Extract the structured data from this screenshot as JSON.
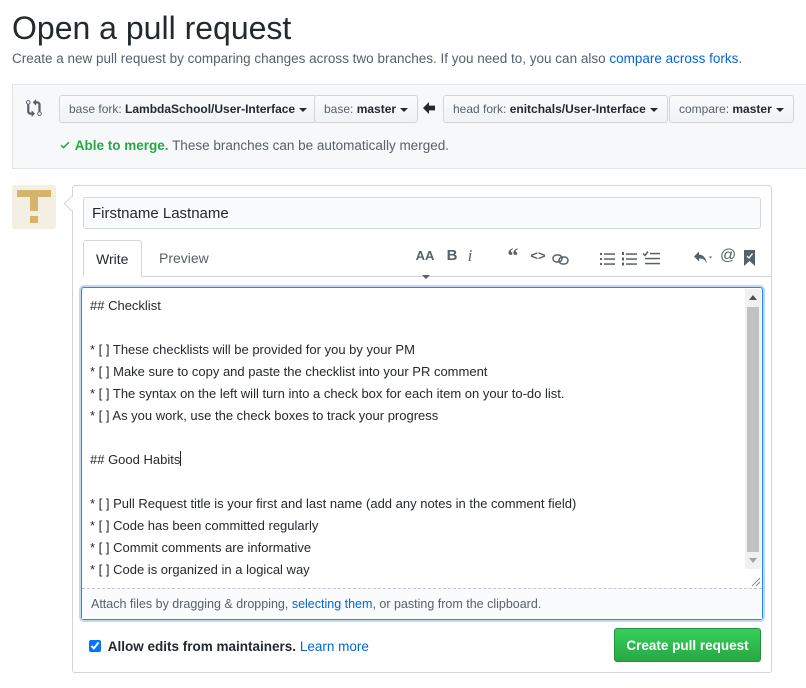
{
  "header": {
    "title": "Open a pull request",
    "subtitle": "Create a new pull request by comparing changes across two branches. If you need to, you can also",
    "subtitle_link": "compare across forks",
    "subtitle_end": "."
  },
  "compare": {
    "base_fork_label": "base fork:",
    "base_fork_value": "LambdaSchool/User-Interface",
    "base_label": "base:",
    "base_value": "master",
    "head_fork_label": "head fork:",
    "head_fork_value": "enitchals/User-Interface",
    "compare_label": "compare:",
    "compare_value": "master",
    "merge_check_icon": "check-icon",
    "merge_ok": "Able to merge.",
    "merge_text": "These branches can be automatically merged."
  },
  "form": {
    "title_value": "Firstname Lastname",
    "tabs": [
      "Write",
      "Preview"
    ],
    "toolbar": {
      "header": "AA",
      "bold": "B",
      "italic": "i",
      "quote": "“",
      "code": "<>",
      "link": "link-icon",
      "ul": "unordered-list-icon",
      "ol": "ordered-list-icon",
      "task": "task-list-icon",
      "reply": "reply-icon",
      "mention": "@",
      "saved": "bookmark-icon"
    },
    "body_lines": [
      "## Checklist",
      "",
      "* [ ] These checklists will be provided for you by your PM",
      "* [ ] Make sure to copy and paste the checklist into your PR comment",
      "* [ ] The syntax on the left will turn into a check box for each item on your to-do list.",
      "* [ ] As you work, use the check boxes to track your progress",
      "",
      "## Good Habits",
      "",
      "* [ ] Pull Request title is your first and last name (add any notes in the comment field)",
      "* [ ] Code has been committed regularly",
      "* [ ] Commit comments are informative",
      "* [ ] Code is organized in a logical way"
    ],
    "attach_prefix": "Attach files by dragging & dropping, ",
    "attach_link": "selecting them",
    "attach_suffix": ", or pasting from the clipboard.",
    "allow_edits_label": "Allow edits from maintainers.",
    "allow_edits_checked": true,
    "learn_more": "Learn more",
    "submit_label": "Create pull request"
  },
  "colors": {
    "link": "#0366d6",
    "success": "#28a745",
    "focus": "#2188ff"
  }
}
